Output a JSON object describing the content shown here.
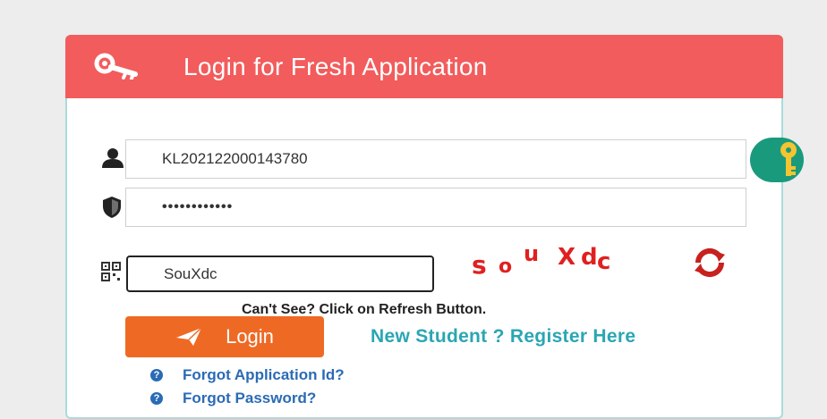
{
  "header": {
    "title": "Login for Fresh Application"
  },
  "form": {
    "application_id_value": "KL202122000143780",
    "password_value": "••••••••••••",
    "captcha_input_value": "SouXdc",
    "captcha_image_text": [
      "s",
      "o",
      "u",
      "X",
      "d",
      "c"
    ],
    "captcha_hint": "Can't See? Click on Refresh Button.",
    "login_label": "Login",
    "register_label": "New Student ? Register Here",
    "forgot_application_id_label": "Forgot Application Id?",
    "forgot_password_label": "Forgot Password?"
  },
  "colors": {
    "header_bg": "#f25c5c",
    "login_button": "#ee6a24",
    "register_link": "#2aa6b4",
    "help_link": "#2a6bb5",
    "captcha_text": "#e02020",
    "badge": "#1a9a7c"
  },
  "icons": {
    "header": "key-icon",
    "application_id": "user-icon",
    "password": "shield-icon",
    "captcha": "qr-icon",
    "refresh": "refresh-icon",
    "login": "paper-plane-icon",
    "help": "question-circle-icon",
    "badge": "key-badge-icon"
  }
}
